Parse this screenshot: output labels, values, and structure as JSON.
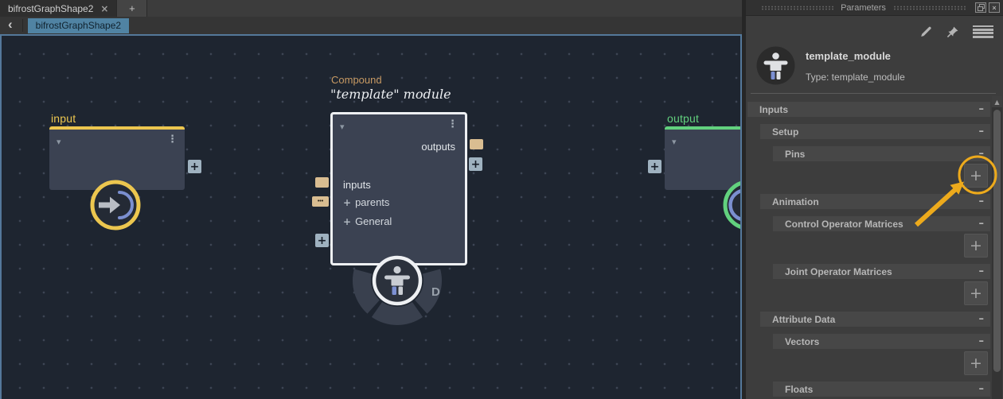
{
  "tabs": {
    "active_label": "bifrostGraphShape2"
  },
  "nav": {
    "breadcrumb": "bifrostGraphShape2"
  },
  "graph": {
    "input_node": {
      "label": "input"
    },
    "compound_node": {
      "type_label": "Compound",
      "title": "\"template\" module",
      "outputs_label": "outputs",
      "inputs_label": "inputs",
      "expand_rows": [
        "parents",
        "General"
      ],
      "state_badge": "D"
    },
    "output_node": {
      "label": "output"
    }
  },
  "panel": {
    "title": "Parameters",
    "node_name": "template_module",
    "node_type": "Type: template_module",
    "sections": [
      {
        "label": "Inputs",
        "level": 1
      },
      {
        "label": "Setup",
        "level": 2
      },
      {
        "label": "Pins",
        "level": 3
      },
      {
        "add_button": true,
        "highlighted": true
      },
      {
        "label": "Animation",
        "level": 2
      },
      {
        "label": "Control Operator Matrices",
        "level": 3
      },
      {
        "add_button": true
      },
      {
        "label": "Joint Operator Matrices",
        "level": 3
      },
      {
        "add_button": true
      },
      {
        "label": "Attribute Data",
        "level": 2
      },
      {
        "label": "Vectors",
        "level": 3
      },
      {
        "add_button": true
      },
      {
        "label": "Floats",
        "level": 3
      }
    ]
  },
  "icons": {
    "close_glyph": "×",
    "new_tab_glyph": "+",
    "back_glyph": "‹",
    "dropdown_glyph": "▾",
    "menu_dots_glyph": "⋮",
    "collapse_glyph": "–",
    "add_glyph": "+",
    "scroll_up_glyph": "▲",
    "port_dots_glyph": "•••"
  },
  "colors": {
    "input_accent": "#ecc64f",
    "output_accent": "#62d17e",
    "annotation": "#edaa1c",
    "port_tan": "#d9bd91",
    "wire_blue": "#7b8fd0",
    "compound_border": "#eef0f3"
  }
}
